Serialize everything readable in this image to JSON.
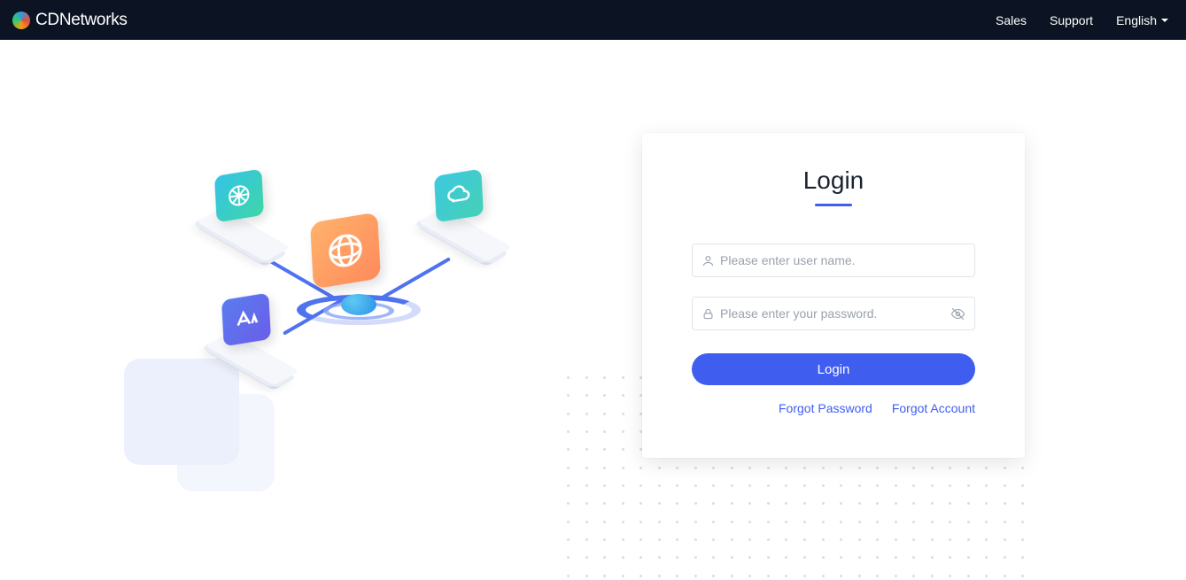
{
  "brand": "CDNetworks",
  "nav": {
    "sales": "Sales",
    "support": "Support",
    "language": "English"
  },
  "login": {
    "title": "Login",
    "username_placeholder": "Please enter user name.",
    "password_placeholder": "Please enter your password.",
    "button": "Login",
    "forgot_password": "Forgot Password",
    "forgot_account": "Forgot Account"
  }
}
